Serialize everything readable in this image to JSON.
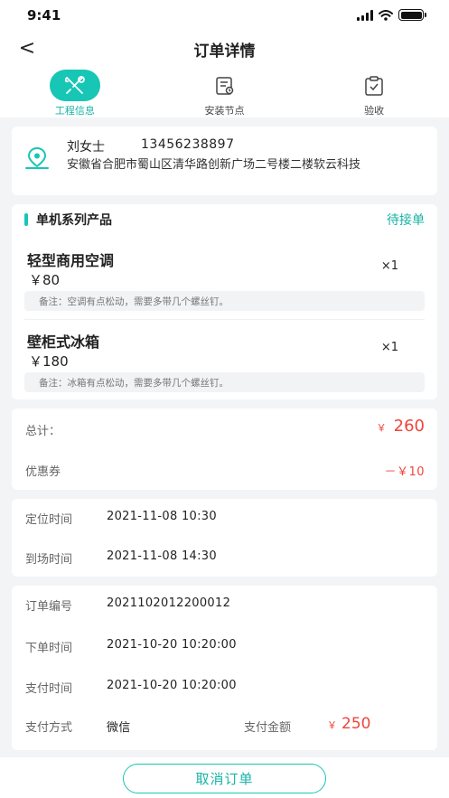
{
  "status_bar": {
    "time": "9:41"
  },
  "nav": {
    "back_glyph": "<",
    "title": "订单详情"
  },
  "tabs": [
    {
      "label": "工程信息",
      "icon": "tools-icon",
      "active": true
    },
    {
      "label": "安装节点",
      "icon": "install-node-icon",
      "active": false
    },
    {
      "label": "验收",
      "icon": "clipboard-check-icon",
      "active": false
    }
  ],
  "contact": {
    "name": "刘女士",
    "phone": "13456238897",
    "address": "安徽省合肥市蜀山区清华路创新广场二号楼二楼软云科技"
  },
  "products_section": {
    "title": "单机系列产品",
    "status": "待接单",
    "items": [
      {
        "name": "轻型商用空调",
        "price": "￥80",
        "qty": "×1",
        "note": "备注：空调有点松动，需要多带几个螺丝钉。"
      },
      {
        "name": "壁柜式冰箱",
        "price": "￥180",
        "qty": "×1",
        "note": "备注：冰箱有点松动，需要多带几个螺丝钉。"
      }
    ]
  },
  "totals": {
    "total_label": "总计：",
    "currency": "￥",
    "total_value": "260",
    "coupon_label": "优惠券",
    "coupon_value": "－￥10"
  },
  "times": {
    "locate_label": "定位时间",
    "locate_value": "2021-11-08 10:30",
    "arrive_label": "到场时间",
    "arrive_value": "2021-11-08 14:30"
  },
  "order": {
    "number_label": "订单编号",
    "number_value": "2021102012200012",
    "order_time_label": "下单时间",
    "order_time_value": "2021-10-20 10:20:00",
    "pay_time_label": "支付时间",
    "pay_time_value": "2021-10-20 10:20:00",
    "pay_method_label": "支付方式",
    "pay_method_value": "微信",
    "pay_amount_label": "支付金额",
    "pay_amount_value": "250"
  },
  "actions": {
    "cancel_label": "取消订单"
  },
  "colors": {
    "accent": "#17c6b5",
    "price_red": "#f0443c",
    "background": "#f3f4f6"
  }
}
